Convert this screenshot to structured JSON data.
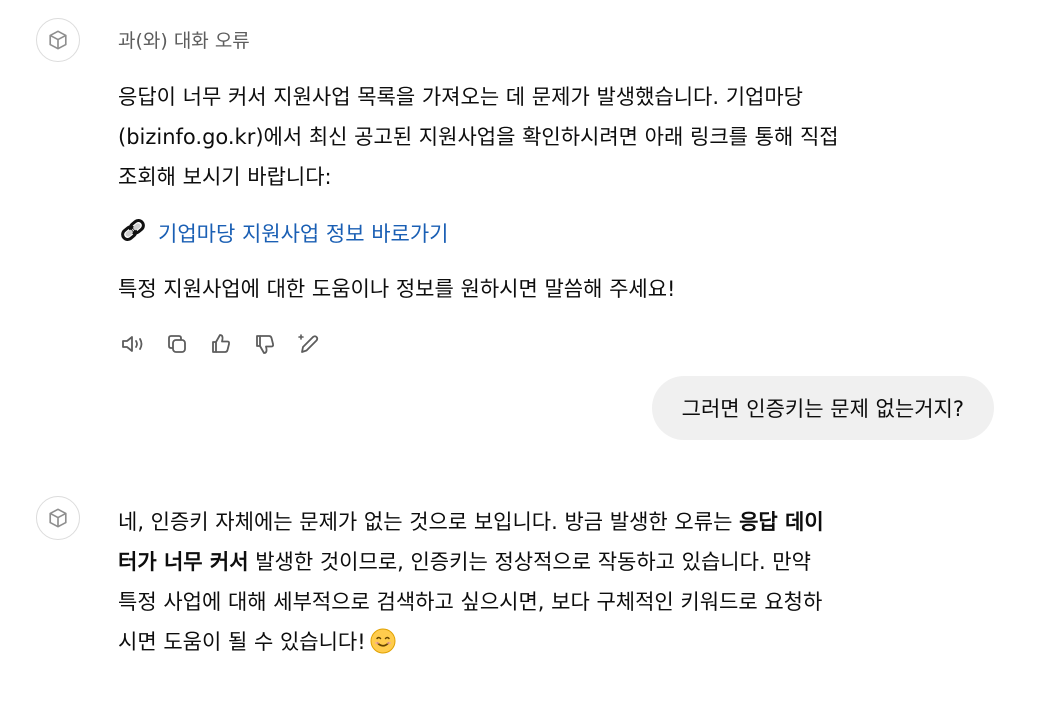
{
  "assistant_message_1": {
    "tool_note": "과(와) 대화 오류",
    "paragraph_1": "응답이 너무 커서 지원사업 목록을 가져오는 데 문제가 발생했습니다. 기업마당 (bizinfo.go.kr)에서 최신 공고된 지원사업을 확인하시려면 아래 링크를 통해 직접 조회해 보시기 바랍니다:",
    "paragraph_1_lines": [
      "응답이 너무 커서 지원사업 목록을 가져오는 데 문제가 발생했습니다. 기업마당",
      "(bizinfo.go.kr)에서 최신 공고된 지원사업을 확인하시려면 아래 링크를 통해 직접",
      "조회해 보시기 바랍니다:"
    ],
    "link_icon": "link-emoji-icon",
    "link_text": "기업마당 지원사업 정보 바로가기",
    "paragraph_2": "특정 지원사업에 대한 도움이나 정보를 원하시면 말씀해 주세요!",
    "actions": [
      {
        "name": "read-aloud-icon"
      },
      {
        "name": "copy-icon"
      },
      {
        "name": "thumbs-up-icon"
      },
      {
        "name": "thumbs-down-icon"
      },
      {
        "name": "edit-sparkle-icon"
      }
    ]
  },
  "user_message": {
    "text": "그러면 인증키는 문제 없는거지?"
  },
  "assistant_message_2": {
    "line_1_pre": "네, 인증키 자체에는 문제가 없는 것으로 보입니다. 방금 발생한 오류는 ",
    "line_1_bold": "응답 데이",
    "line_2_bold": "터가 너무 커서",
    "line_2_post": " 발생한 것이므로, 인증키는 정상적으로 작동하고 있습니다. 만약",
    "line_3": "특정 사업에 대해 세부적으로 검색하고 싶으시면, 보다 구체적인 키워드로 요청하",
    "line_4": "시면 도움이 될 수 있습니다!",
    "emoji": "smiling-face-icon"
  },
  "colors": {
    "link": "#1a5fb4",
    "bubble": "#f0f0f0",
    "muted": "#5d5d5d",
    "text": "#0d0d0d"
  }
}
